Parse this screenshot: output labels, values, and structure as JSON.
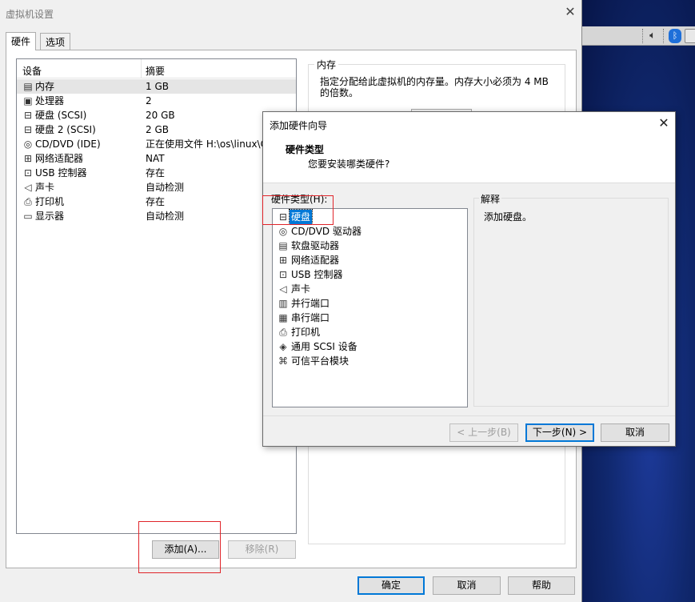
{
  "main_window": {
    "title": "虚拟机设置",
    "close_glyph": "✕",
    "tabs": [
      {
        "label": "硬件"
      },
      {
        "label": "选项"
      }
    ],
    "device_list": {
      "headers": {
        "device": "设备",
        "summary": "摘要"
      },
      "rows": [
        {
          "icon": "memory-icon",
          "glyph": "▤",
          "name": "内存",
          "summary": "1 GB"
        },
        {
          "icon": "processor-icon",
          "glyph": "▣",
          "name": "处理器",
          "summary": "2"
        },
        {
          "icon": "hard-disk-icon",
          "glyph": "⊟",
          "name": "硬盘 (SCSI)",
          "summary": "20 GB"
        },
        {
          "icon": "hard-disk-icon",
          "glyph": "⊟",
          "name": "硬盘 2 (SCSI)",
          "summary": "2 GB"
        },
        {
          "icon": "cd-dvd-icon",
          "glyph": "◎",
          "name": "CD/DVD (IDE)",
          "summary": "正在使用文件 H:\\os\\linux\\C"
        },
        {
          "icon": "network-adapter-icon",
          "glyph": "⊞",
          "name": "网络适配器",
          "summary": "NAT"
        },
        {
          "icon": "usb-icon",
          "glyph": "⊡",
          "name": "USB 控制器",
          "summary": "存在"
        },
        {
          "icon": "sound-card-icon",
          "glyph": "◁",
          "name": "声卡",
          "summary": "自动检测"
        },
        {
          "icon": "printer-icon",
          "glyph": "⎙",
          "name": "打印机",
          "summary": "存在"
        },
        {
          "icon": "display-icon",
          "glyph": "▭",
          "name": "显示器",
          "summary": "自动检测"
        }
      ]
    },
    "memory_panel": {
      "title": "内存",
      "description_line1": "指定分配给此虚拟机的内存量。内存大小必须为 4 MB",
      "description_line2": "的倍数。"
    },
    "buttons": {
      "add": "添加(A)...",
      "remove": "移除(R)",
      "ok": "确定",
      "cancel": "取消",
      "help": "帮助"
    }
  },
  "wizard": {
    "title": "添加硬件向导",
    "close_glyph": "✕",
    "heading": "硬件类型",
    "subheading": "您要安装哪类硬件?",
    "list_label": "硬件类型(H):",
    "hardware_types": [
      {
        "icon": "hard-disk-icon",
        "glyph": "⊟",
        "label": "硬盘"
      },
      {
        "icon": "cd-dvd-icon",
        "glyph": "◎",
        "label": "CD/DVD 驱动器"
      },
      {
        "icon": "floppy-icon",
        "glyph": "▤",
        "label": "软盘驱动器"
      },
      {
        "icon": "network-adapter-icon",
        "glyph": "⊞",
        "label": "网络适配器"
      },
      {
        "icon": "usb-icon",
        "glyph": "⊡",
        "label": "USB 控制器"
      },
      {
        "icon": "sound-card-icon",
        "glyph": "◁",
        "label": "声卡"
      },
      {
        "icon": "parallel-port-icon",
        "glyph": "▥",
        "label": "并行端口"
      },
      {
        "icon": "serial-port-icon",
        "glyph": "▦",
        "label": "串行端口"
      },
      {
        "icon": "printer-icon",
        "glyph": "⎙",
        "label": "打印机"
      },
      {
        "icon": "scsi-device-icon",
        "glyph": "◈",
        "label": "通用 SCSI 设备"
      },
      {
        "icon": "trusted-platform-icon",
        "glyph": "⌘",
        "label": "可信平台模块"
      }
    ],
    "selected_index": 0,
    "explain_title": "解释",
    "explain_text": "添加硬盘。",
    "buttons": {
      "back": "< 上一步(B)",
      "next": "下一步(N) >",
      "cancel": "取消"
    }
  },
  "colors": {
    "selection": "#0078d7",
    "highlight_box": "#e0252a"
  }
}
